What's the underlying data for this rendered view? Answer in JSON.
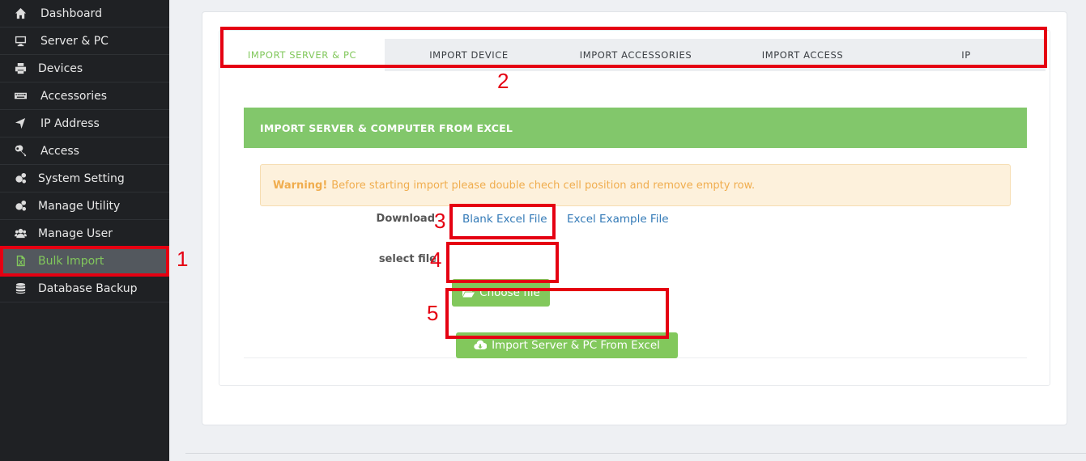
{
  "sidebar": {
    "items": [
      {
        "label": "Dashboard",
        "icon": "home-icon"
      },
      {
        "label": "Server & PC",
        "icon": "monitor-icon"
      },
      {
        "label": "Devices",
        "icon": "printer-icon"
      },
      {
        "label": "Accessories",
        "icon": "keyboard-icon"
      },
      {
        "label": "IP Address",
        "icon": "location-arrow-icon"
      },
      {
        "label": "Access",
        "icon": "key-icon"
      },
      {
        "label": "System Setting",
        "icon": "gears-icon"
      },
      {
        "label": "Manage Utility",
        "icon": "gears-icon"
      },
      {
        "label": "Manage User",
        "icon": "users-icon"
      },
      {
        "label": "Bulk Import",
        "icon": "file-excel-icon"
      },
      {
        "label": "Database Backup",
        "icon": "database-icon"
      }
    ]
  },
  "tabs": [
    {
      "label": "IMPORT SERVER & PC"
    },
    {
      "label": "IMPORT DEVICE"
    },
    {
      "label": "IMPORT ACCESSORIES"
    },
    {
      "label": "IMPORT ACCESS"
    },
    {
      "label": "IP"
    }
  ],
  "panel": {
    "title": "IMPORT SERVER & COMPUTER FROM EXCEL",
    "warning_strong": "Warning!",
    "warning_text": "Before starting import please double chech cell position and remove empty row.",
    "download_label": "Download",
    "blank_link": "Blank Excel File",
    "example_link": "Excel Example File",
    "select_label": "select file",
    "choose_button": "Choose file",
    "import_button": "Import Server & PC From Excel"
  },
  "annotations": {
    "n1": "1",
    "n2": "2",
    "n3": "3",
    "n4": "4",
    "n5": "5"
  },
  "colors": {
    "accent": "#82c85c",
    "annotation": "#e50012",
    "sidebar_bg": "#1f2124",
    "link": "#337ab7",
    "warning_text": "#f0ad4e"
  }
}
